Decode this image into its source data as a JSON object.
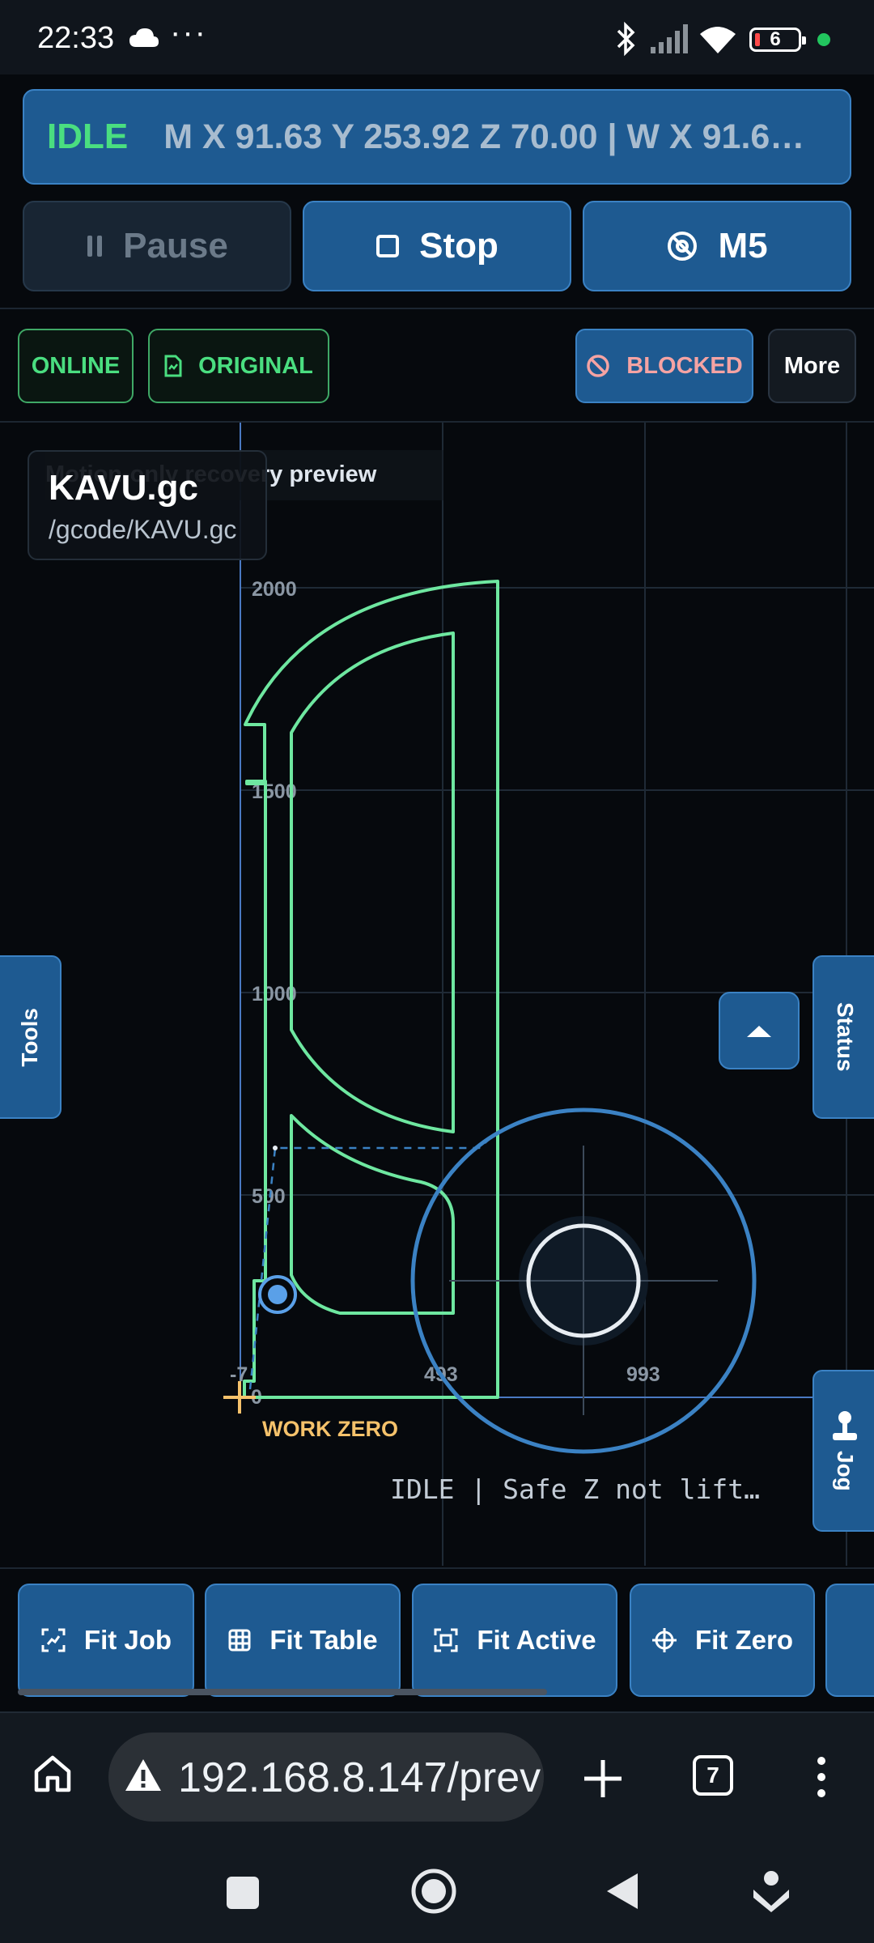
{
  "status_bar": {
    "time": "22:33",
    "dots": "···",
    "battery": "6",
    "icons": [
      "cloud-icon",
      "bluetooth-icon",
      "signal-icon",
      "wifi-icon",
      "battery-icon"
    ]
  },
  "machine": {
    "state": "IDLE",
    "coords": "M X 91.63 Y 253.92 Z 70.00 | W X 91.6…"
  },
  "controls": {
    "pause": "Pause",
    "stop": "Stop",
    "m5": "M5"
  },
  "badges": {
    "online": "ONLINE",
    "original": "ORIGINAL",
    "blocked": "BLOCKED",
    "more": "More"
  },
  "preview": {
    "recovery_note": "Motion-only recovery preview",
    "file_title": "KAVU.gc",
    "file_path": "/gcode/KAVU.gc",
    "y_ticks": [
      "2000",
      "1500",
      "1000",
      "500",
      "0"
    ],
    "x_ticks": [
      "-7",
      "493",
      "993"
    ],
    "work_zero": "WORK ZERO",
    "status_line": "IDLE | Safe Z not lift…",
    "accent_green": "#6ee7a0",
    "accent_blue": "#3b82c4",
    "zero_color": "#f5c26b"
  },
  "side_tabs": {
    "tools": "Tools",
    "status": "Status",
    "jog": "Jog"
  },
  "fit_bar": {
    "fit_job": "Fit Job",
    "fit_table": "Fit Table",
    "fit_active": "Fit Active",
    "fit_zero": "Fit Zero"
  },
  "browser": {
    "url": "192.168.8.147/prev",
    "tab_count": "7"
  }
}
